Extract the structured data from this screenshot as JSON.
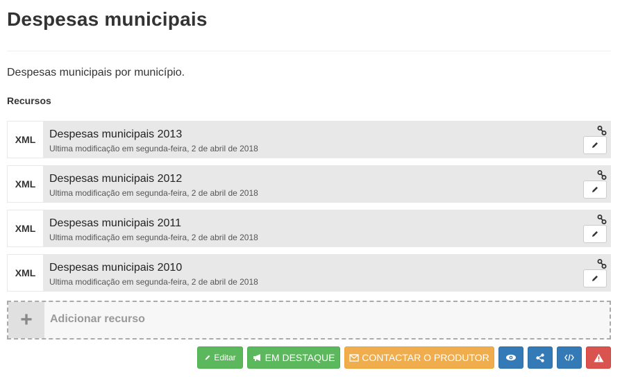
{
  "page": {
    "title": "Despesas municipais",
    "description": "Despesas municipais por município."
  },
  "resources_section": {
    "heading": "Recursos",
    "items": [
      {
        "format": "XML",
        "title": "Despesas municipais 2013",
        "meta": "Ultima modificação em segunda-feira, 2 de abril de 2018"
      },
      {
        "format": "XML",
        "title": "Despesas municipais 2012",
        "meta": "Ultima modificação em segunda-feira, 2 de abril de 2018"
      },
      {
        "format": "XML",
        "title": "Despesas municipais 2011",
        "meta": "Ultima modificação em segunda-feira, 2 de abril de 2018"
      },
      {
        "format": "XML",
        "title": "Despesas municipais 2010",
        "meta": "Ultima modificação em segunda-feira, 2 de abril de 2018"
      }
    ],
    "add": {
      "label": "Adicionar recurso",
      "icon": "plus-icon"
    }
  },
  "actions": {
    "edit": {
      "label": "Editar",
      "icon": "pencil-icon"
    },
    "featured": {
      "label": "EM DESTAQUE",
      "icon": "bullhorn-icon"
    },
    "contact": {
      "label": "CONTACTAR O PRODUTOR",
      "icon": "envelope-icon"
    },
    "icons": [
      "eye-icon",
      "share-icon",
      "code-icon",
      "warning-icon"
    ]
  },
  "colors": {
    "green": "#5cb85c",
    "orange": "#f0ad4e",
    "blue": "#337ab7",
    "red": "#d9534f",
    "resource_bg": "#e8e8e8"
  }
}
